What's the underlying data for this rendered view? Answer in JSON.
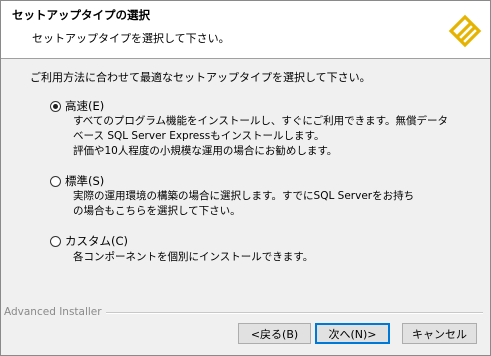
{
  "header": {
    "title": "セットアップタイプの選択",
    "subtitle": "セットアップタイプを選択して下さい。"
  },
  "intro": "ご利用方法に合わせて最適なセットアップタイプを選択して下さい。",
  "options": [
    {
      "label": "高速(E)",
      "selected": true,
      "description": [
        "すべてのプログラム機能をインストールし、すぐにご利用できます。無償データ",
        "ベース SQL Server Expressもインストールします。",
        "評価や10人程度の小規模な運用の場合にお勧めします。"
      ]
    },
    {
      "label": "標準(S)",
      "selected": false,
      "description": [
        "実際の運用環境の構築の場合に選択します。すでにSQL Serverをお持ち",
        "の場合もこちらを選択して下さい。"
      ]
    },
    {
      "label": "カスタム(C)",
      "selected": false,
      "description": [
        "各コンポーネントを個別にインストールできます。"
      ]
    }
  ],
  "footer": {
    "brand": "Advanced Installer",
    "back_label": "<戻る(B)",
    "next_label": "次へ(N)>",
    "cancel_label": "キャンセル"
  },
  "colors": {
    "logo": "#e6b400",
    "default_button_border": "#0078d7"
  }
}
